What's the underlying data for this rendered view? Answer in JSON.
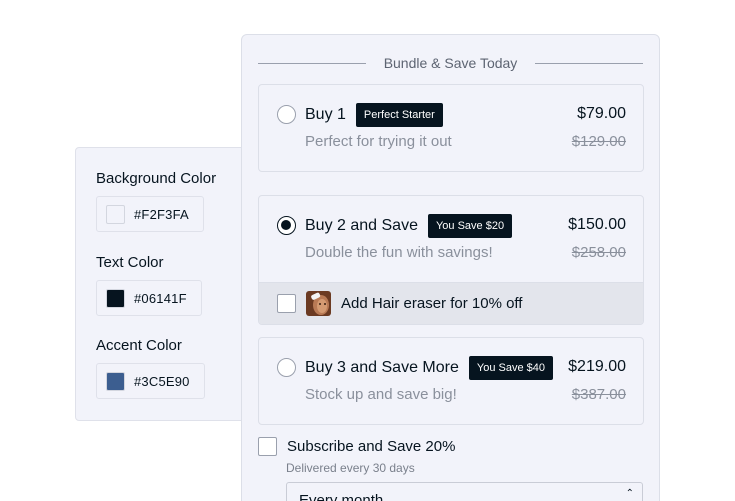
{
  "settings": {
    "background": {
      "label": "Background Color",
      "hex": "#F2F3FA",
      "color": "#F2F3FA"
    },
    "text": {
      "label": "Text Color",
      "hex": "#06141F",
      "color": "#06141F"
    },
    "accent": {
      "label": "Accent Color",
      "hex": "#3C5E90",
      "color": "#3C5E90"
    }
  },
  "bundle": {
    "heading": "Bundle & Save Today",
    "options": [
      {
        "title": "Buy 1",
        "badge": "Perfect Starter",
        "subtitle": "Perfect for trying it out",
        "price": "$79.00",
        "compare_price": "$129.00",
        "selected": false
      },
      {
        "title": "Buy 2 and Save",
        "badge": "You Save $20",
        "subtitle": "Double the fun with savings!",
        "price": "$150.00",
        "compare_price": "$258.00",
        "selected": true,
        "addon": {
          "label": "Add Hair eraser for 10% off",
          "checked": false,
          "thumbnail_icon": "product-photo"
        }
      },
      {
        "title": "Buy 3 and Save More",
        "badge": "You Save $40",
        "subtitle": "Stock up and save big!",
        "price": "$219.00",
        "compare_price": "$387.00",
        "selected": false
      }
    ],
    "subscribe": {
      "label": "Subscribe and Save 20%",
      "note": "Delivered every 30 days",
      "checked": false,
      "frequency": "Every month"
    }
  }
}
